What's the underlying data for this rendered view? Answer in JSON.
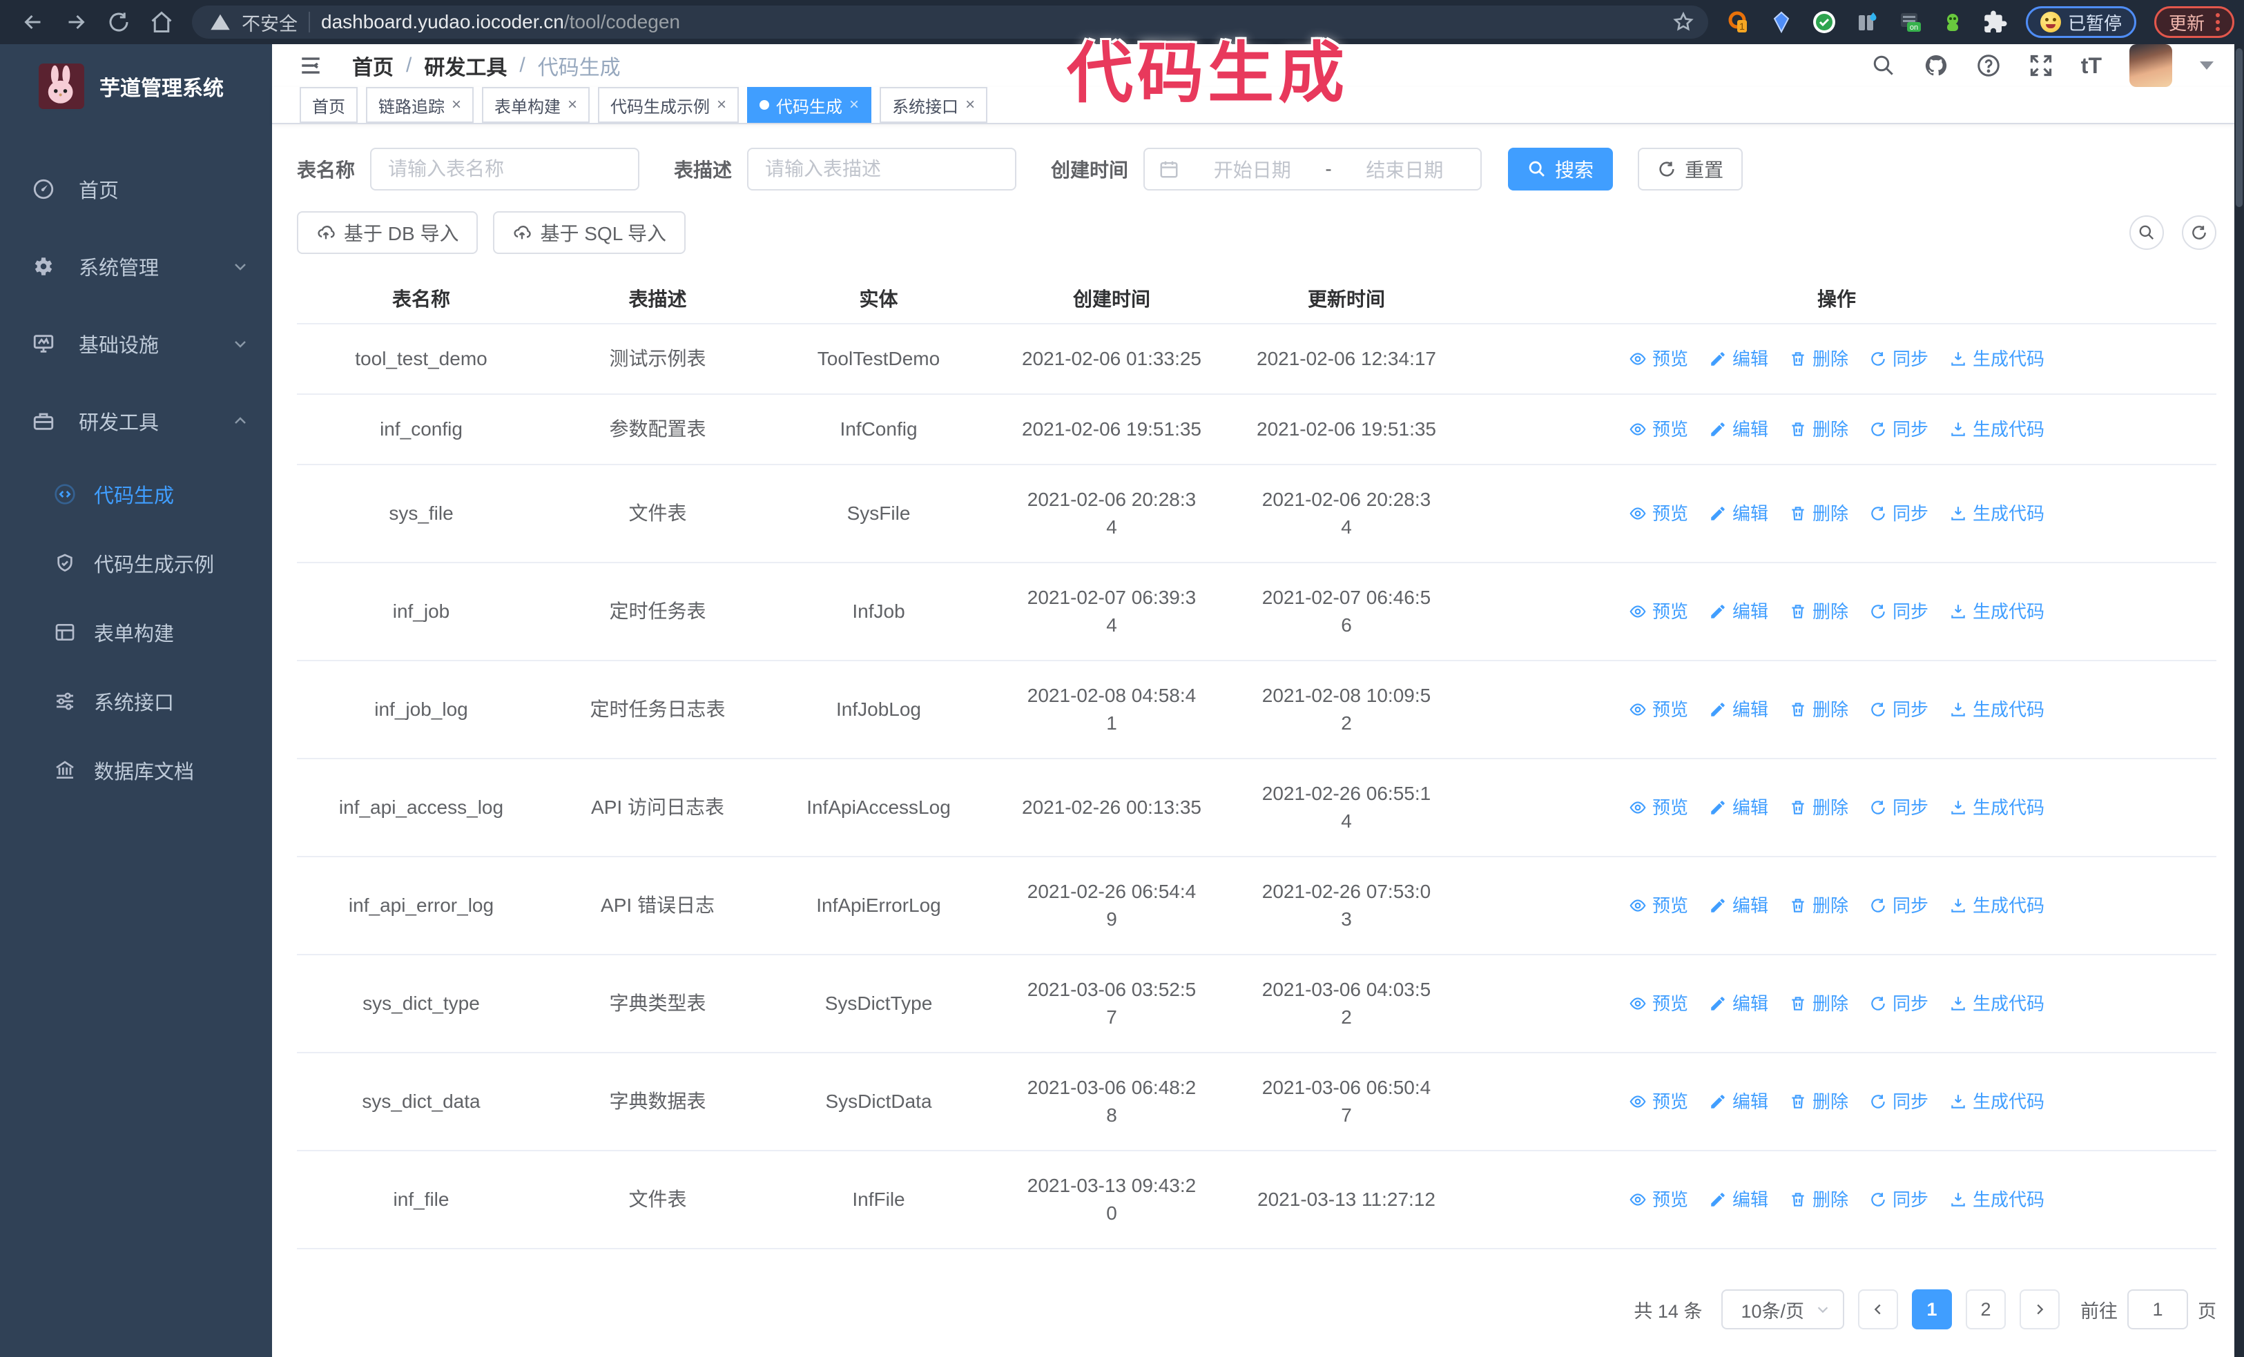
{
  "browser": {
    "security_label": "不安全",
    "url_host": "dashboard.yudao.iocoder.cn",
    "url_path": "/tool/codegen",
    "extension_badge": "1",
    "extension_on_badge": "on",
    "paused_badge": "已暂停",
    "update_button": "更新"
  },
  "annotation": {
    "text": "代码生成",
    "color": "#e8395c"
  },
  "sidebar": {
    "app_title": "芋道管理系统",
    "items": [
      {
        "label": "首页",
        "icon": "dashboard-icon",
        "expandable": false
      },
      {
        "label": "系统管理",
        "icon": "gear-icon",
        "expandable": true
      },
      {
        "label": "基础设施",
        "icon": "monitor-icon",
        "expandable": true
      },
      {
        "label": "研发工具",
        "icon": "toolbox-icon",
        "expandable": true,
        "expanded": true
      }
    ],
    "submenu": [
      {
        "label": "代码生成",
        "icon": "code-icon",
        "active": true
      },
      {
        "label": "代码生成示例",
        "icon": "shield-check-icon",
        "active": false
      },
      {
        "label": "表单构建",
        "icon": "form-icon",
        "active": false
      },
      {
        "label": "系统接口",
        "icon": "sliders-icon",
        "active": false
      },
      {
        "label": "数据库文档",
        "icon": "database-doc-icon",
        "active": false
      }
    ]
  },
  "breadcrumb": {
    "separator": "/",
    "items": [
      "首页",
      "研发工具",
      "代码生成"
    ]
  },
  "tabs": [
    {
      "label": "首页",
      "closable": false,
      "active": false
    },
    {
      "label": "链路追踪",
      "closable": true,
      "active": false
    },
    {
      "label": "表单构建",
      "closable": true,
      "active": false
    },
    {
      "label": "代码生成示例",
      "closable": true,
      "active": false
    },
    {
      "label": "代码生成",
      "closable": true,
      "active": true
    },
    {
      "label": "系统接口",
      "closable": true,
      "active": false
    }
  ],
  "filters": {
    "table_name_label": "表名称",
    "table_name_placeholder": "请输入表名称",
    "table_desc_label": "表描述",
    "table_desc_placeholder": "请输入表描述",
    "create_time_label": "创建时间",
    "date_start_placeholder": "开始日期",
    "date_separator": "-",
    "date_end_placeholder": "结束日期",
    "search_label": "搜索",
    "reset_label": "重置"
  },
  "toolbar": {
    "import_db_label": "基于 DB 导入",
    "import_sql_label": "基于 SQL 导入"
  },
  "table": {
    "columns": [
      "表名称",
      "表描述",
      "实体",
      "创建时间",
      "更新时间",
      "操作"
    ],
    "actions": [
      "预览",
      "编辑",
      "删除",
      "同步",
      "生成代码"
    ],
    "rows": [
      {
        "name": "tool_test_demo",
        "desc": "测试示例表",
        "entity": "ToolTestDemo",
        "created": "2021-02-06 01:33:25",
        "updated": "2021-02-06 12:34:17"
      },
      {
        "name": "inf_config",
        "desc": "参数配置表",
        "entity": "InfConfig",
        "created": "2021-02-06 19:51:35",
        "updated": "2021-02-06 19:51:35"
      },
      {
        "name": "sys_file",
        "desc": "文件表",
        "entity": "SysFile",
        "created": "2021-02-06 20:28:3\n4",
        "updated": "2021-02-06 20:28:3\n4"
      },
      {
        "name": "inf_job",
        "desc": "定时任务表",
        "entity": "InfJob",
        "created": "2021-02-07 06:39:3\n4",
        "updated": "2021-02-07 06:46:5\n6"
      },
      {
        "name": "inf_job_log",
        "desc": "定时任务日志表",
        "entity": "InfJobLog",
        "created": "2021-02-08 04:58:4\n1",
        "updated": "2021-02-08 10:09:5\n2"
      },
      {
        "name": "inf_api_access_log",
        "desc": "API 访问日志表",
        "entity": "InfApiAccessLog",
        "created": "2021-02-26 00:13:35",
        "updated": "2021-02-26 06:55:1\n4"
      },
      {
        "name": "inf_api_error_log",
        "desc": "API 错误日志",
        "entity": "InfApiErrorLog",
        "created": "2021-02-26 06:54:4\n9",
        "updated": "2021-02-26 07:53:0\n3"
      },
      {
        "name": "sys_dict_type",
        "desc": "字典类型表",
        "entity": "SysDictType",
        "created": "2021-03-06 03:52:5\n7",
        "updated": "2021-03-06 04:03:5\n2"
      },
      {
        "name": "sys_dict_data",
        "desc": "字典数据表",
        "entity": "SysDictData",
        "created": "2021-03-06 06:48:2\n8",
        "updated": "2021-03-06 06:50:4\n7"
      },
      {
        "name": "inf_file",
        "desc": "文件表",
        "entity": "InfFile",
        "created": "2021-03-13 09:43:2\n0",
        "updated": "2021-03-13 11:27:12"
      }
    ]
  },
  "pagination": {
    "total_text": "共 14 条",
    "page_size": "10条/页",
    "pages": [
      "1",
      "2"
    ],
    "active_page": "1",
    "goto_label": "前往",
    "goto_value": "1",
    "goto_suffix": "页"
  },
  "colors": {
    "accent": "#409eff",
    "sidebar_bg": "#304156",
    "chrome_bg": "#212b39",
    "annotation_pink": "#e8395c",
    "update_border": "#e2574c",
    "paused_border": "#4f8df6",
    "table_border": "#ebeef5",
    "text_primary": "#303133",
    "text_regular": "#606266"
  }
}
